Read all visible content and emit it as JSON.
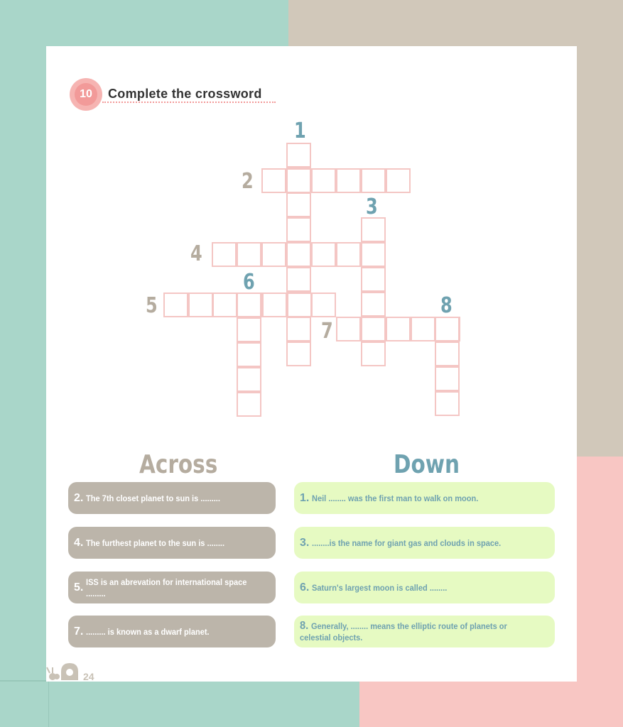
{
  "exercise": {
    "number": "10",
    "title": "Complete the crossword"
  },
  "grid": {
    "cells": [
      [
        5,
        1
      ],
      [
        5,
        2
      ],
      [
        5,
        3
      ],
      [
        5,
        4
      ],
      [
        5,
        5
      ],
      [
        5,
        6
      ],
      [
        5,
        7
      ],
      [
        5,
        8
      ],
      [
        5,
        9
      ],
      [
        4,
        2
      ],
      [
        6,
        2
      ],
      [
        7,
        2
      ],
      [
        8,
        2
      ],
      [
        9,
        2
      ],
      [
        3,
        2
      ],
      [
        4,
        4
      ],
      [
        7,
        4
      ],
      [
        8,
        4
      ],
      [
        7,
        3
      ],
      [
        6,
        4
      ],
      [
        6,
        5
      ],
      [
        6,
        6
      ],
      [
        6,
        7
      ],
      [
        6,
        8
      ],
      [
        6,
        9
      ],
      [
        6,
        10
      ],
      [
        3,
        6
      ],
      [
        4,
        6
      ],
      [
        5,
        6
      ],
      [
        6,
        6
      ],
      [
        7,
        6
      ],
      [
        8,
        6
      ],
      [
        9,
        6
      ],
      [
        10,
        6
      ],
      [
        4,
        8
      ],
      [
        5,
        8
      ],
      [
        6,
        8
      ],
      [
        7,
        8
      ],
      [
        8,
        8
      ],
      [
        9,
        8
      ],
      [
        0,
        5
      ],
      [
        1,
        5
      ],
      [
        2,
        5
      ],
      [
        3,
        5
      ],
      [
        4,
        5
      ],
      [
        5,
        5
      ],
      [
        6,
        5
      ],
      [
        7,
        5
      ],
      [
        8,
        5
      ],
      [
        9,
        5
      ],
      [
        1,
        6
      ],
      [
        1,
        7
      ],
      [
        1,
        8
      ],
      [
        1,
        9
      ],
      [
        1,
        10
      ],
      [
        7,
        8
      ],
      [
        7,
        9
      ],
      [
        7,
        10
      ],
      [
        7,
        11
      ],
      [
        7,
        12
      ]
    ],
    "numbers": [
      {
        "n": "1",
        "dir": "down"
      },
      {
        "n": "2",
        "dir": "across"
      },
      {
        "n": "3",
        "dir": "down"
      },
      {
        "n": "4",
        "dir": "across"
      },
      {
        "n": "6",
        "dir": "down"
      },
      {
        "n": "5",
        "dir": "across"
      },
      {
        "n": "8",
        "dir": "down"
      },
      {
        "n": "7",
        "dir": "across"
      }
    ]
  },
  "across": {
    "heading": "Across",
    "clues": [
      {
        "n": "2.",
        "text": "The 7th closet planet to sun is ........."
      },
      {
        "n": "4.",
        "text": "The furthest planet to the sun is ........"
      },
      {
        "n": "5.",
        "text": "ISS is an abrevation for international space ........."
      },
      {
        "n": "7.",
        "text": "......... is known as a dwarf planet."
      }
    ]
  },
  "down": {
    "heading": "Down",
    "clues": [
      {
        "n": "1.",
        "text": "Neil ........ was the first man to walk on moon."
      },
      {
        "n": "3.",
        "text": "........is the name for giant gas and clouds in space."
      },
      {
        "n": "6.",
        "text": "Saturn's largest moon is called ........"
      },
      {
        "n": "8.",
        "text": "Generally, ........ means the elliptic route of planets or celestial objects."
      }
    ]
  },
  "footer": {
    "page_number": "24"
  },
  "colors": {
    "teal": "#a9d6c9",
    "tan": "#d1c8ba",
    "pink": "#f8c6c3",
    "across_text": "#b5ac9f",
    "down_text": "#6fa2b0",
    "cell_border": "#f4c6c4",
    "down_clue_bg": "#e6fac2"
  }
}
